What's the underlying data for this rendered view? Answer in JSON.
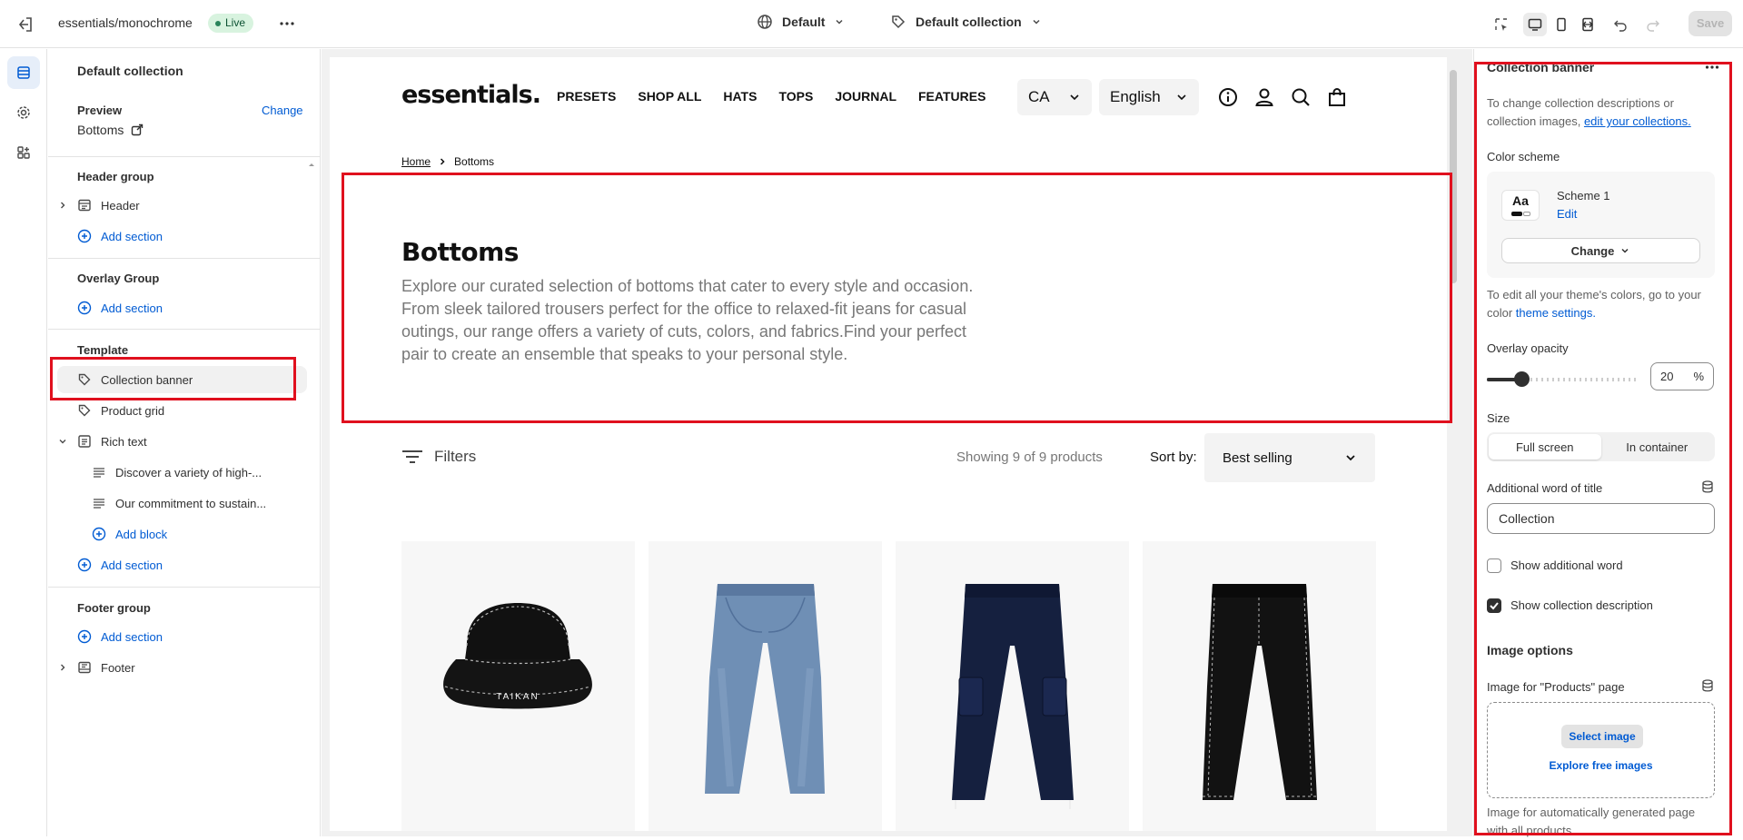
{
  "topbar": {
    "store_path": "essentials/monochrome",
    "live_badge": "Live",
    "theme_select": "Default",
    "template_select": "Default collection",
    "save_label": "Save"
  },
  "left_panel": {
    "title": "Default collection",
    "preview_label": "Preview",
    "preview_change": "Change",
    "preview_value": "Bottoms",
    "header_group": "Header group",
    "header_item": "Header",
    "add_section": "Add section",
    "overlay_group": "Overlay Group",
    "template_group": "Template",
    "collection_banner": "Collection banner",
    "product_grid": "Product grid",
    "rich_text": "Rich text",
    "rich_block_1": "Discover a variety of high-...",
    "rich_block_2": "Our commitment to sustain...",
    "add_block": "Add block",
    "footer_group": "Footer group",
    "footer_item": "Footer"
  },
  "preview": {
    "logo": "essentials.",
    "nav": [
      "PRESETS",
      "SHOP ALL",
      "HATS",
      "TOPS",
      "JOURNAL",
      "FEATURES"
    ],
    "country": "CA",
    "language": "English",
    "breadcrumb_home": "Home",
    "breadcrumb_current": "Bottoms",
    "banner_title": "Bottoms",
    "banner_description": "Explore our curated selection of bottoms that cater to every style and occasion. From sleek tailored trousers perfect for the office to relaxed-fit jeans for casual outings, our range offers a variety of cuts, colors, and fabrics.Find your perfect pair to create an ensemble that speaks to your personal style.",
    "filters_label": "Filters",
    "showing": "Showing 9 of 9 products",
    "sort_by_label": "Sort by:",
    "sort_value": "Best selling",
    "hat_text": "TAIKAN"
  },
  "right_panel": {
    "title": "Collection banner",
    "info_prefix": "To change collection descriptions or collection images, ",
    "info_link": "edit your collections.",
    "color_scheme_label": "Color scheme",
    "aa": "Aa",
    "scheme_name": "Scheme 1",
    "scheme_edit": "Edit",
    "scheme_change": "Change",
    "theme_colors_prefix": "To edit all your theme's colors, go to your color ",
    "theme_colors_link": "theme settings.",
    "overlay_label": "Overlay opacity",
    "overlay_value": "20",
    "overlay_unit": "%",
    "overlay_fraction": 0.2,
    "size_label": "Size",
    "size_options": [
      "Full screen",
      "In container"
    ],
    "size_selected": "Full screen",
    "additional_word_label": "Additional word of title",
    "additional_word_value": "Collection",
    "show_additional_word": "Show additional word",
    "show_additional_word_checked": false,
    "show_collection_desc": "Show collection description",
    "show_collection_desc_checked": true,
    "image_options_heading": "Image options",
    "image_products_label": "Image for \"Products\" page",
    "select_image": "Select image",
    "explore_free_images": "Explore free images",
    "image_auto_label": "Image for automatically generated page with all products"
  },
  "colors": {
    "accent_blue": "#005bd3",
    "live_green": "#29845a",
    "highlight_red": "#e0101e"
  }
}
